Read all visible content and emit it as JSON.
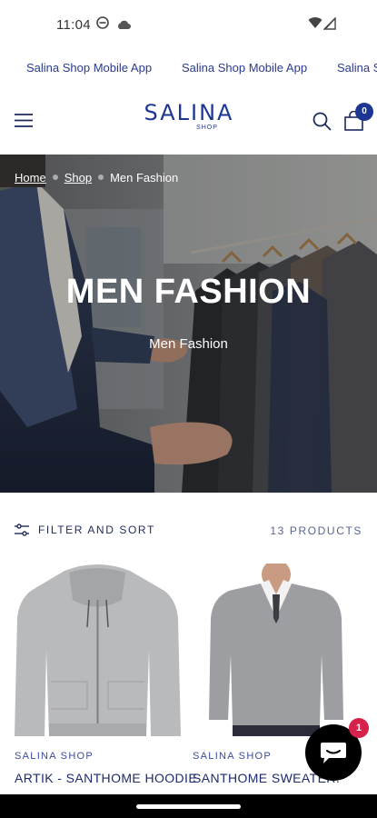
{
  "status_bar": {
    "time": "11:04",
    "icons": [
      "dnd-icon",
      "cloud-icon",
      "wifi-icon",
      "signal-icon"
    ]
  },
  "announcement": {
    "items": [
      "Salina Shop Mobile App",
      "Salina Shop Mobile App",
      "Salina S"
    ]
  },
  "header": {
    "logo_main": "SALINA",
    "logo_sub": "SHOP",
    "cart_count": "0",
    "icons": [
      "menu-icon",
      "search-icon",
      "cart-icon"
    ]
  },
  "hero": {
    "breadcrumb": [
      "Home",
      "Shop",
      "Men Fashion"
    ],
    "title": "MEN FASHION",
    "subtitle": "Men Fashion"
  },
  "collection": {
    "filter_label": "FILTER AND SORT",
    "product_count": "13 PRODUCTS",
    "products": [
      {
        "vendor": "SALINA SHOP",
        "title": "ARTIK - SANTHOME HOODIE"
      },
      {
        "vendor": "SALINA SHOP",
        "title": "SANTHOME SWEATER."
      }
    ]
  },
  "chat": {
    "badge": "1"
  },
  "colors": {
    "brand": "#1d3694",
    "text": "#1e2a5e",
    "badge_red": "#d6224a"
  }
}
